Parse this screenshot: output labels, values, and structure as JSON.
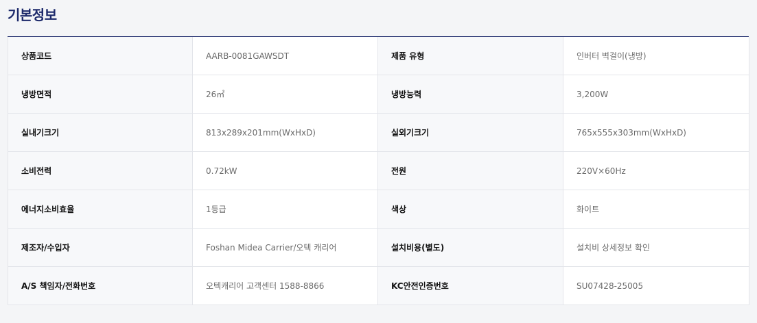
{
  "section": {
    "title": "기본정보"
  },
  "colors": {
    "title": "#1d2a6b",
    "label_bg": "#f7f8fa",
    "value_bg": "#ffffff"
  },
  "rows": [
    {
      "l1": "상품코드",
      "v1": "AARB-0081GAWSDT",
      "l2": "제품 유형",
      "v2": "인버터 벽걸이(냉방)"
    },
    {
      "l1": "냉방면적",
      "v1": "26㎡",
      "l2": "냉방능력",
      "v2": "3,200W"
    },
    {
      "l1": "실내기크기",
      "v1": "813x289x201mm(WxHxD)",
      "l2": "실외기크기",
      "v2": "765x555x303mm(WxHxD)"
    },
    {
      "l1": "소비전력",
      "v1": "0.72kW",
      "l2": "전원",
      "v2": "220V×60Hz"
    },
    {
      "l1": "에너지소비효율",
      "v1": "1등급",
      "l2": "색상",
      "v2": "화이트"
    },
    {
      "l1": "제조자/수입자",
      "v1": "Foshan Midea Carrier/오텍 캐리어",
      "l2": "설치비용(별도)",
      "v2": "설치비 상세정보 확인"
    },
    {
      "l1": "A/S 책임자/전화번호",
      "v1": "오텍캐리어 고객센터 1588-8866",
      "l2": "KC안전인증번호",
      "v2": "SU07428-25005"
    }
  ]
}
